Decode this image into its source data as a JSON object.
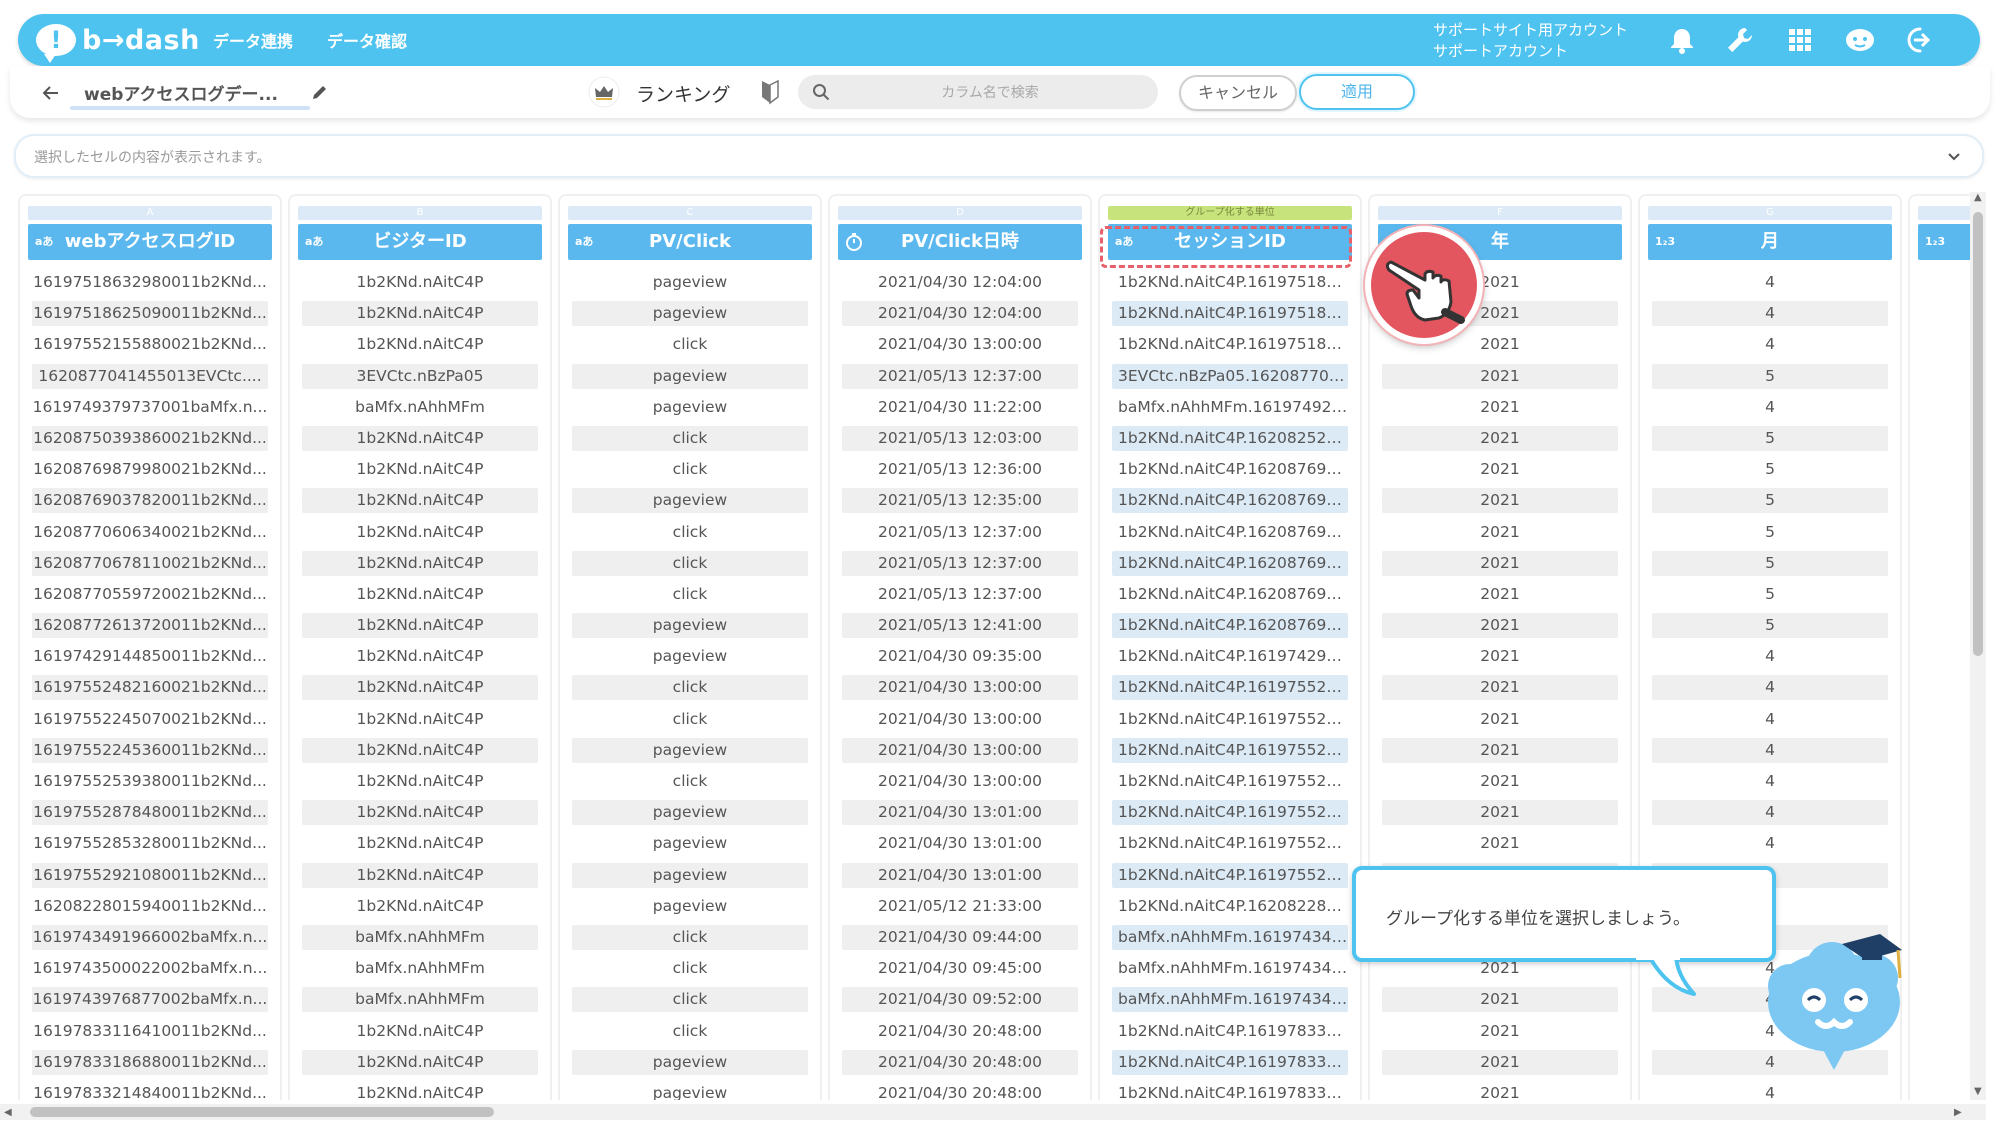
{
  "header": {
    "logo_text": "b→dash",
    "nav": [
      "データ連携",
      "データ確認"
    ],
    "account_line1": "サポートサイト用アカウント",
    "account_line2": "サポートアカウント",
    "icons": [
      "bell-icon",
      "wrench-icon",
      "apps-grid-icon",
      "mascot-face-icon",
      "logout-icon"
    ]
  },
  "toolbar": {
    "dataset_name": "webアクセスログデー...",
    "ranking_label": "ランキング",
    "search_placeholder": "カラム名で検索",
    "cancel_label": "キャンセル",
    "apply_label": "適用"
  },
  "preview": {
    "placeholder": "選択したセルの内容が表示されます。"
  },
  "columns": [
    {
      "letter": "A",
      "name": "webアクセスログID",
      "type": "aあ"
    },
    {
      "letter": "B",
      "name": "ビジターID",
      "type": "aあ"
    },
    {
      "letter": "C",
      "name": "PV/Click",
      "type": "aあ"
    },
    {
      "letter": "D",
      "name": "PV/Click日時",
      "type": "clock"
    },
    {
      "letter": "E",
      "name": "セッションID",
      "type": "aあ",
      "group_label": "グループ化する単位"
    },
    {
      "letter": "F",
      "name": "年",
      "type": ""
    },
    {
      "letter": "G",
      "name": "月",
      "type": "1₂3"
    },
    {
      "letter": "H",
      "name": "",
      "type": "1₂3"
    }
  ],
  "rows": {
    "A": [
      "16197518632980011b2KNd...",
      "16197518625090011b2KNd...",
      "16197552155880021b2KNd...",
      "1620877041455013EVCtc....",
      "1619749379737001baMfx.n...",
      "16208750393860021b2KNd...",
      "16208769879980021b2KNd...",
      "16208769037820011b2KNd...",
      "16208770606340021b2KNd...",
      "16208770678110021b2KNd...",
      "16208770559720021b2KNd...",
      "16208772613720011b2KNd...",
      "16197429144850011b2KNd...",
      "16197552482160021b2KNd...",
      "16197552245070021b2KNd...",
      "16197552245360011b2KNd...",
      "16197552539380011b2KNd...",
      "16197552878480011b2KNd...",
      "16197552853280011b2KNd...",
      "16197552921080011b2KNd...",
      "16208228015940011b2KNd...",
      "1619743491966002baMfx.n...",
      "1619743500022002baMfx.n...",
      "1619743976877002baMfx.n...",
      "16197833116410011b2KNd...",
      "16197833186880011b2KNd...",
      "16197833214840011b2KNd..."
    ],
    "B": [
      "1b2KNd.nAitC4P",
      "1b2KNd.nAitC4P",
      "1b2KNd.nAitC4P",
      "3EVCtc.nBzPa05",
      "baMfx.nAhhMFm",
      "1b2KNd.nAitC4P",
      "1b2KNd.nAitC4P",
      "1b2KNd.nAitC4P",
      "1b2KNd.nAitC4P",
      "1b2KNd.nAitC4P",
      "1b2KNd.nAitC4P",
      "1b2KNd.nAitC4P",
      "1b2KNd.nAitC4P",
      "1b2KNd.nAitC4P",
      "1b2KNd.nAitC4P",
      "1b2KNd.nAitC4P",
      "1b2KNd.nAitC4P",
      "1b2KNd.nAitC4P",
      "1b2KNd.nAitC4P",
      "1b2KNd.nAitC4P",
      "1b2KNd.nAitC4P",
      "baMfx.nAhhMFm",
      "baMfx.nAhhMFm",
      "baMfx.nAhhMFm",
      "1b2KNd.nAitC4P",
      "1b2KNd.nAitC4P",
      "1b2KNd.nAitC4P"
    ],
    "C": [
      "pageview",
      "pageview",
      "click",
      "pageview",
      "pageview",
      "click",
      "click",
      "pageview",
      "click",
      "click",
      "click",
      "pageview",
      "pageview",
      "click",
      "click",
      "pageview",
      "click",
      "pageview",
      "pageview",
      "pageview",
      "pageview",
      "click",
      "click",
      "click",
      "click",
      "pageview",
      "pageview"
    ],
    "D": [
      "2021/04/30 12:04:00",
      "2021/04/30 12:04:00",
      "2021/04/30 13:00:00",
      "2021/05/13 12:37:00",
      "2021/04/30 11:22:00",
      "2021/05/13 12:03:00",
      "2021/05/13 12:36:00",
      "2021/05/13 12:35:00",
      "2021/05/13 12:37:00",
      "2021/05/13 12:37:00",
      "2021/05/13 12:37:00",
      "2021/05/13 12:41:00",
      "2021/04/30 09:35:00",
      "2021/04/30 13:00:00",
      "2021/04/30 13:00:00",
      "2021/04/30 13:00:00",
      "2021/04/30 13:00:00",
      "2021/04/30 13:01:00",
      "2021/04/30 13:01:00",
      "2021/04/30 13:01:00",
      "2021/05/12 21:33:00",
      "2021/04/30 09:44:00",
      "2021/04/30 09:45:00",
      "2021/04/30 09:52:00",
      "2021/04/30 20:48:00",
      "2021/04/30 20:48:00",
      "2021/04/30 20:48:00"
    ],
    "E": [
      "1b2KNd.nAitC4P.161975180...",
      "1b2KNd.nAitC4P.161975180...",
      "1b2KNd.nAitC4P.161975180...",
      "3EVCtc.nBzPa05.162087702...",
      "baMfx.nAhhMFm.161974929...",
      "1b2KNd.nAitC4P.162082526...",
      "1b2KNd.nAitC4P.162087690...",
      "1b2KNd.nAitC4P.162087690...",
      "1b2KNd.nAitC4P.162087690...",
      "1b2KNd.nAitC4P.162087690...",
      "1b2KNd.nAitC4P.162087690...",
      "1b2KNd.nAitC4P.162087690...",
      "1b2KNd.nAitC4P.161974291...",
      "1b2KNd.nAitC4P.161975521...",
      "1b2KNd.nAitC4P.161975521...",
      "1b2KNd.nAitC4P.161975521...",
      "1b2KNd.nAitC4P.161975521...",
      "1b2KNd.nAitC4P.161975521...",
      "1b2KNd.nAitC4P.161975521...",
      "1b2KNd.nAitC4P.161975521...",
      "1b2KNd.nAitC4P.162082280...",
      "baMfx.nAhhMFm.161974348...",
      "baMfx.nAhhMFm.161974348...",
      "baMfx.nAhhMFm.161974348...",
      "1b2KNd.nAitC4P.161978330...",
      "1b2KNd.nAitC4P.161978330...",
      "1b2KNd.nAitC4P.161978330..."
    ],
    "F": [
      "2021",
      "2021",
      "2021",
      "2021",
      "2021",
      "2021",
      "2021",
      "2021",
      "2021",
      "2021",
      "2021",
      "2021",
      "2021",
      "2021",
      "2021",
      "2021",
      "2021",
      "2021",
      "2021",
      "",
      "",
      "",
      "2021",
      "2021",
      "2021",
      "2021",
      "2021"
    ],
    "G": [
      "4",
      "4",
      "4",
      "5",
      "4",
      "5",
      "5",
      "5",
      "5",
      "5",
      "5",
      "5",
      "4",
      "4",
      "4",
      "4",
      "4",
      "4",
      "4",
      "",
      "",
      "",
      "4",
      "4",
      "4",
      "4",
      "4"
    ]
  },
  "tutorial": {
    "tooltip_text": "グループ化する単位を選択しましょう。"
  },
  "colors": {
    "brand": "#4fc3f0",
    "header_cell": "#5ab8ef",
    "highlight": "#e8606a",
    "group_label_bg": "#c6e37c"
  }
}
